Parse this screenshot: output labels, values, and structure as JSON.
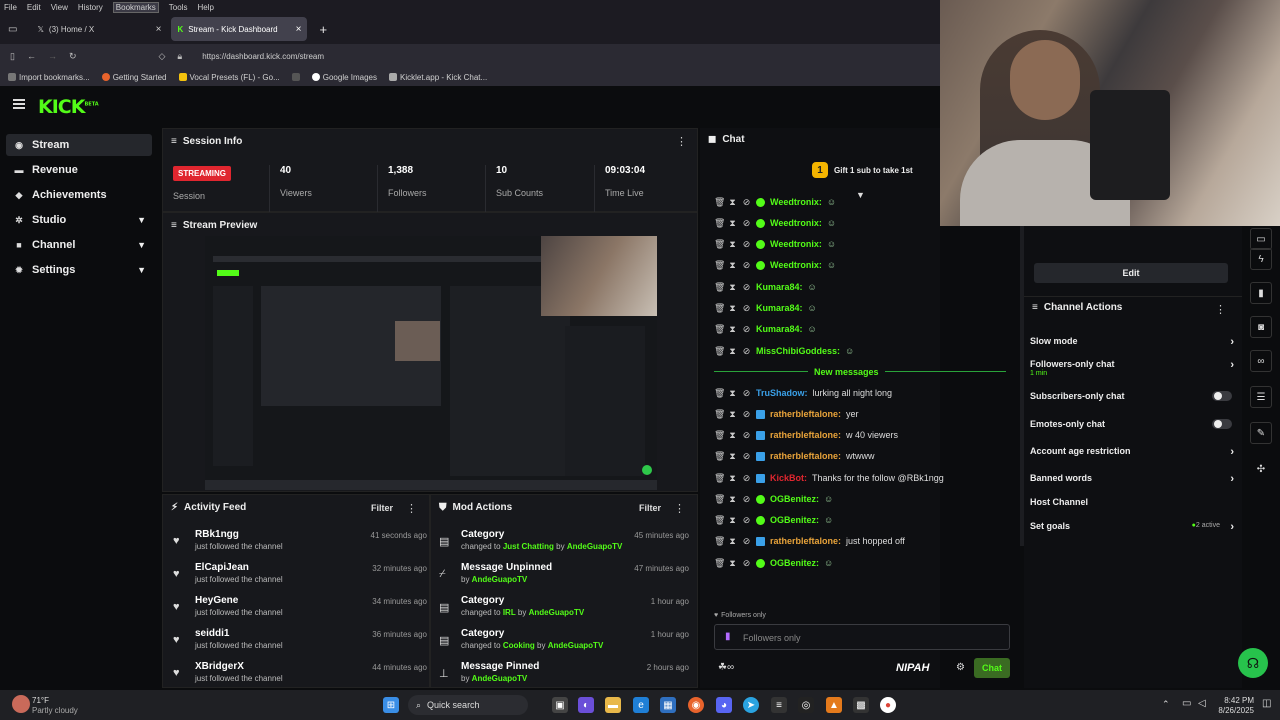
{
  "browser": {
    "menu": [
      "File",
      "Edit",
      "View",
      "History",
      "Bookmarks",
      "Tools",
      "Help"
    ],
    "tabs": [
      {
        "label": "(3) Home / X",
        "icon": "x-logo-icon"
      },
      {
        "label": "Stream - Kick Dashboard",
        "icon": "kick-logo-icon"
      }
    ],
    "url": "https://dashboard.kick.com/stream",
    "bookmarks": [
      "Import bookmarks...",
      "Getting Started",
      "Vocal Presets (FL) - Go...",
      "Google Images",
      "Kicklet.app - Kick Chat..."
    ]
  },
  "app": {
    "logo": "KICK",
    "logo_badge": "BETA",
    "nav": [
      {
        "label": "Stream",
        "icon": "radio-icon",
        "has_chevron": false,
        "active": true
      },
      {
        "label": "Revenue",
        "icon": "dollar-icon",
        "has_chevron": false,
        "active": false
      },
      {
        "label": "Achievements",
        "icon": "trophy-icon",
        "has_chevron": false,
        "active": false
      },
      {
        "label": "Studio",
        "icon": "gear-icon",
        "has_chevron": true,
        "active": false
      },
      {
        "label": "Channel",
        "icon": "channel-icon",
        "has_chevron": true,
        "active": false
      },
      {
        "label": "Settings",
        "icon": "settings-icon",
        "has_chevron": true,
        "active": false
      }
    ]
  },
  "session": {
    "title": "Session Info",
    "status": "STREAMING",
    "status_label": "Session",
    "stats": [
      {
        "value": "40",
        "label": "Viewers"
      },
      {
        "value": "1,388",
        "label": "Followers"
      },
      {
        "value": "10",
        "label": "Sub Counts"
      },
      {
        "value": "09:03:04",
        "label": "Time Live"
      }
    ]
  },
  "preview": {
    "title": "Stream Preview"
  },
  "activity": {
    "title": "Activity Feed",
    "filter": "Filter",
    "items": [
      {
        "name": "RBk1ngg",
        "action": "just followed the channel",
        "time": "41 seconds ago"
      },
      {
        "name": "ElCapiJean",
        "action": "just followed the channel",
        "time": "32 minutes ago"
      },
      {
        "name": "HeyGene",
        "action": "just followed the channel",
        "time": "34 minutes ago"
      },
      {
        "name": "seiddi1",
        "action": "just followed the channel",
        "time": "36 minutes ago"
      },
      {
        "name": "XBridgerX",
        "action": "just followed the channel",
        "time": "44 minutes ago"
      }
    ]
  },
  "mod": {
    "title": "Mod Actions",
    "filter": "Filter",
    "items": [
      {
        "title": "Category",
        "pre": "changed to ",
        "hl": "Just Chatting",
        "by": " by ",
        "user": "AndeGuapoTV",
        "time": "45 minutes ago",
        "icon": "category-icon"
      },
      {
        "title": "Message Unpinned",
        "pre": "",
        "hl": "",
        "by": "by ",
        "user": "AndeGuapoTV",
        "time": "47 minutes ago",
        "icon": "unpin-icon"
      },
      {
        "title": "Category",
        "pre": "changed to ",
        "hl": "IRL",
        "by": " by ",
        "user": "AndeGuapoTV",
        "time": "1 hour ago",
        "icon": "category-icon"
      },
      {
        "title": "Category",
        "pre": "changed to ",
        "hl": "Cooking",
        "by": " by ",
        "user": "AndeGuapoTV",
        "time": "1 hour ago",
        "icon": "category-icon"
      },
      {
        "title": "Message Pinned",
        "pre": "",
        "hl": "",
        "by": "by ",
        "user": "AndeGuapoTV",
        "time": "2 hours ago",
        "icon": "pin-icon"
      }
    ]
  },
  "chat": {
    "title": "Chat",
    "gift": "Gift 1 sub to take 1st",
    "new_messages": "New messages",
    "messages": [
      {
        "user": "Weedtronix",
        "color": "#53fc18",
        "badge": "green",
        "text": ""
      },
      {
        "user": "Weedtronix",
        "color": "#53fc18",
        "badge": "green",
        "text": ""
      },
      {
        "user": "Weedtronix",
        "color": "#53fc18",
        "badge": "green",
        "text": ""
      },
      {
        "user": "Weedtronix",
        "color": "#53fc18",
        "badge": "green",
        "text": ""
      },
      {
        "user": "Kumara84",
        "color": "#53fc18",
        "badge": "",
        "text": ""
      },
      {
        "user": "Kumara84",
        "color": "#53fc18",
        "badge": "",
        "text": ""
      },
      {
        "user": "Kumara84",
        "color": "#53fc18",
        "badge": "",
        "text": ""
      },
      {
        "user": "MissChibiGoddess",
        "color": "#53fc18",
        "badge": "",
        "text": ""
      },
      {
        "user": "TruShadow",
        "color": "#3aa0e8",
        "badge": "",
        "text": "lurking all night long"
      },
      {
        "user": "ratherbleftalone",
        "color": "#e8a33a",
        "badge": "blue",
        "text": "yer"
      },
      {
        "user": "ratherbleftalone",
        "color": "#e8a33a",
        "badge": "blue",
        "text": "w 40 viewers"
      },
      {
        "user": "ratherbleftalone",
        "color": "#e8a33a",
        "badge": "blue",
        "text": "wtwww"
      },
      {
        "user": "KickBot",
        "color": "#e0262f",
        "badge": "blue",
        "text": "Thanks for the follow @RBk1ngg"
      },
      {
        "user": "OGBenitez",
        "color": "#53fc18",
        "badge": "green",
        "text": ""
      },
      {
        "user": "OGBenitez",
        "color": "#53fc18",
        "badge": "green",
        "text": ""
      },
      {
        "user": "ratherbleftalone",
        "color": "#e8a33a",
        "badge": "blue",
        "text": "just hopped off"
      },
      {
        "user": "OGBenitez",
        "color": "#53fc18",
        "badge": "green",
        "text": ""
      }
    ],
    "followers_only_note": "Followers only",
    "input_placeholder": "Followers only",
    "emote_label": "NIPAH",
    "send": "Chat"
  },
  "channel_actions": {
    "edit": "Edit",
    "title": "Channel Actions",
    "items": [
      {
        "label": "Slow mode",
        "type": "arrow",
        "sub": ""
      },
      {
        "label": "Followers-only chat",
        "type": "arrow",
        "sub": "1 min"
      },
      {
        "label": "Subscribers-only chat",
        "type": "toggle",
        "sub": ""
      },
      {
        "label": "Emotes-only chat",
        "type": "toggle",
        "sub": ""
      },
      {
        "label": "Account age restriction",
        "type": "arrow",
        "sub": ""
      },
      {
        "label": "Banned words",
        "type": "arrow",
        "sub": ""
      },
      {
        "label": "Host Channel",
        "type": "none",
        "sub": ""
      },
      {
        "label": "Set goals",
        "type": "arrow",
        "sub": "2 active"
      }
    ]
  },
  "taskbar": {
    "weather_temp": "71°F",
    "weather_desc": "Partly cloudy",
    "search": "Quick search",
    "time": "8:42 PM",
    "date": "8/26/2025"
  },
  "colors": {
    "accent": "#53fc18",
    "live": "#e0262f"
  }
}
